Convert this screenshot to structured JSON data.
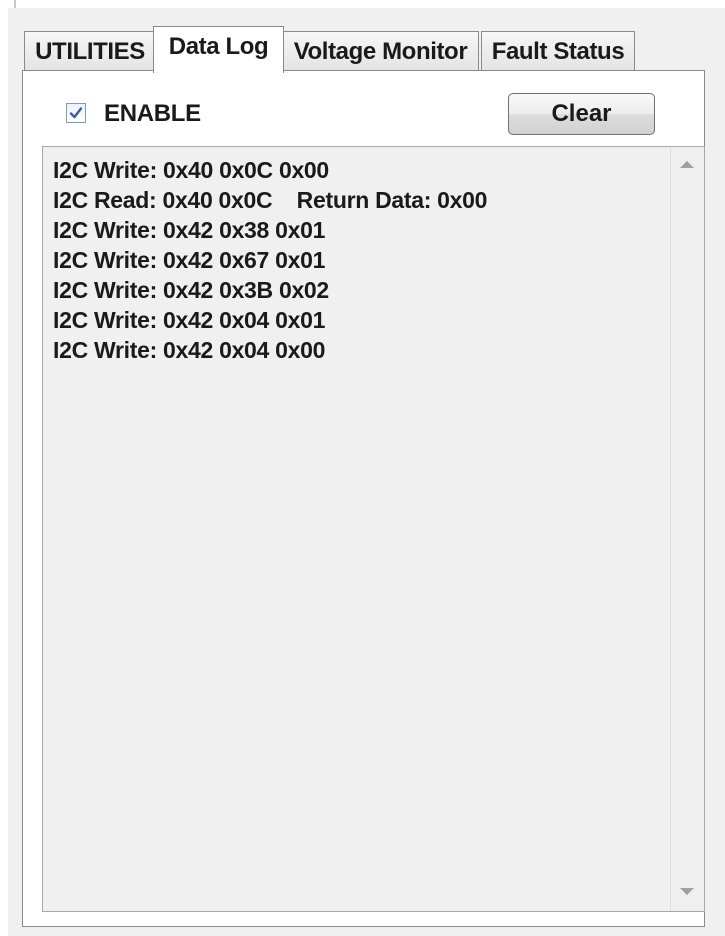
{
  "tabs": [
    {
      "label": "UTILITIES",
      "active": false
    },
    {
      "label": "Data Log",
      "active": true
    },
    {
      "label": "Voltage Monitor",
      "active": false
    },
    {
      "label": "Fault Status",
      "active": false
    }
  ],
  "enable": {
    "label": "ENABLE",
    "checked": true
  },
  "clear_button": {
    "label": "Clear"
  },
  "log": {
    "lines": [
      "I2C Write: 0x40 0x0C 0x00",
      "I2C Read: 0x40 0x0C    Return Data: 0x00",
      "I2C Write: 0x42 0x38 0x01",
      "I2C Write: 0x42 0x67 0x01",
      "I2C Write: 0x42 0x3B 0x02",
      "I2C Write: 0x42 0x04 0x01",
      "I2C Write: 0x42 0x04 0x00"
    ]
  },
  "icons": {
    "checkbox": "checkmark-icon",
    "scroll_up": "scroll-up-arrow-icon",
    "scroll_down": "scroll-down-arrow-icon"
  },
  "colors": {
    "checkmark": "#3a5ba8",
    "window_background": "#f0f0f0",
    "panel_background": "#ffffff"
  }
}
